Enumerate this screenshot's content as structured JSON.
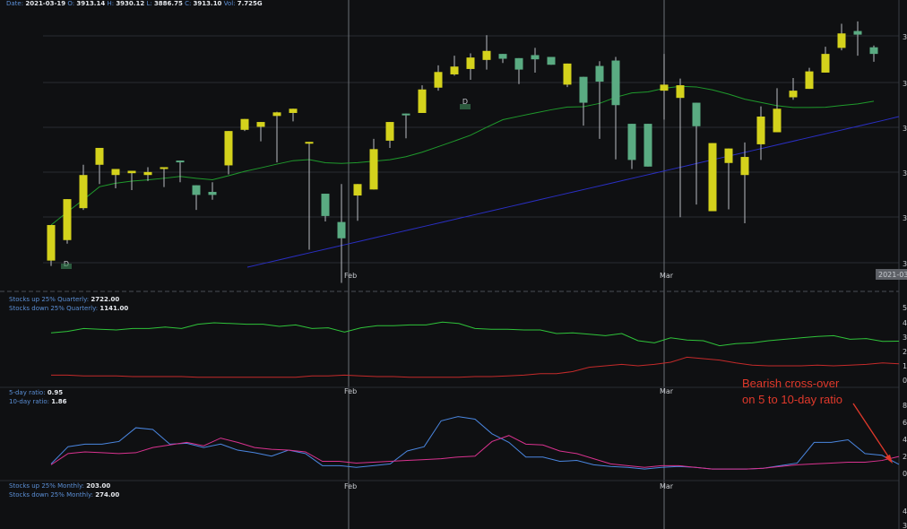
{
  "header": {
    "date_label": "Date:",
    "date": "2021-03-19",
    "o_label": "O:",
    "open": "3913.14",
    "h_label": "H:",
    "high": "3930.12",
    "l_label": "L:",
    "low": "3886.75",
    "c_label": "C:",
    "close": "3913.10",
    "vol_label": "Vol:",
    "vol": "7.725G"
  },
  "xaxis": {
    "labels": [
      "Feb",
      "Mar"
    ],
    "date_badge": "2021-03"
  },
  "price_panel": {
    "marker": "D",
    "yaxis_ticks": [
      "3",
      "3",
      "3",
      "3",
      "3",
      "3"
    ]
  },
  "quarterly_panel": {
    "up_label": "Stocks up 25% Quarterly:",
    "up_value": "2722.00",
    "down_label": "Stocks down 25% Quarterly:",
    "down_value": "1141.00",
    "yaxis_ticks": [
      "5",
      "4",
      "3",
      "2",
      "1",
      "0"
    ]
  },
  "ratio_panel": {
    "five_label": "5-day ratio:",
    "five_value": "0.95",
    "ten_label": "10-day ratio:",
    "ten_value": "1.86",
    "yaxis_ticks": [
      "8",
      "6",
      "4",
      "2",
      "0"
    ],
    "annotation_line1": "Bearish cross-over",
    "annotation_line2": "on 5 to 10-day ratio"
  },
  "monthly_panel": {
    "up_label": "Stocks up 25% Monthly:",
    "up_value": "203.00",
    "down_label": "Stocks down 25% Monthly:",
    "down_value": "274.00",
    "yaxis_ticks": [
      "4",
      "3"
    ]
  },
  "colors": {
    "bg": "#0f1012",
    "bull": "#d4d21c",
    "bear": "#5aab82",
    "ma_short": "#1f9a2c",
    "ma_long": "#2a2fc4",
    "q_up": "#2fc33a",
    "q_down": "#c42a2a",
    "ratio5": "#4a86e0",
    "ratio10": "#d9328f",
    "annotation": "#e0392b"
  },
  "chart_data": {
    "type": "line",
    "series": [
      {
        "name": "Stocks up 25% Quarterly",
        "values": [
          3.3,
          3.4,
          3.6,
          3.55,
          3.5,
          3.6,
          3.6,
          3.7,
          3.6,
          3.9,
          4.0,
          3.95,
          3.9,
          3.9,
          3.75,
          3.85,
          3.6,
          3.65,
          3.35,
          3.65,
          3.8,
          3.8,
          3.85,
          3.85,
          4.05,
          3.95,
          3.6,
          3.55,
          3.55,
          3.5,
          3.5,
          3.25,
          3.3,
          3.2,
          3.1,
          3.25,
          2.75,
          2.6,
          2.95,
          2.8,
          2.75,
          2.4,
          2.55,
          2.6,
          2.75,
          2.85,
          2.95,
          3.05,
          3.1,
          2.85,
          2.9,
          2.7,
          2.72
        ]
      },
      {
        "name": "Stocks down 25% Quarterly",
        "values": [
          0.35,
          0.35,
          0.3,
          0.3,
          0.3,
          0.25,
          0.25,
          0.25,
          0.25,
          0.2,
          0.2,
          0.2,
          0.2,
          0.2,
          0.2,
          0.2,
          0.3,
          0.3,
          0.35,
          0.3,
          0.25,
          0.25,
          0.2,
          0.2,
          0.2,
          0.2,
          0.25,
          0.25,
          0.3,
          0.35,
          0.45,
          0.45,
          0.6,
          0.9,
          1.0,
          1.1,
          1.0,
          1.1,
          1.25,
          1.6,
          1.5,
          1.4,
          1.2,
          1.05,
          1.0,
          1.0,
          1.0,
          1.05,
          1.0,
          1.05,
          1.1,
          1.2,
          1.14
        ]
      },
      {
        "name": "5-day ratio",
        "values": [
          1.0,
          3.0,
          3.3,
          3.3,
          3.6,
          5.2,
          5.0,
          3.3,
          3.4,
          2.9,
          3.3,
          2.6,
          2.3,
          1.9,
          2.6,
          2.2,
          0.8,
          0.8,
          0.6,
          0.8,
          1.0,
          2.5,
          3.0,
          6.0,
          6.5,
          6.2,
          4.5,
          3.5,
          1.8,
          1.8,
          1.3,
          1.4,
          0.9,
          0.7,
          0.6,
          0.4,
          0.6,
          0.7,
          0.6,
          0.4,
          0.4,
          0.4,
          0.5,
          0.8,
          1.1,
          3.5,
          3.5,
          3.8,
          2.2,
          2.0,
          0.95
        ]
      },
      {
        "name": "10-day ratio",
        "values": [
          0.9,
          2.2,
          2.4,
          2.3,
          2.2,
          2.3,
          2.9,
          3.2,
          3.5,
          3.1,
          4.0,
          3.5,
          2.9,
          2.7,
          2.6,
          2.4,
          1.3,
          1.3,
          1.1,
          1.2,
          1.3,
          1.4,
          1.5,
          1.6,
          1.8,
          1.9,
          3.6,
          4.3,
          3.3,
          3.2,
          2.5,
          2.2,
          1.6,
          1.0,
          0.8,
          0.6,
          0.8,
          0.8,
          0.6,
          0.4,
          0.4,
          0.4,
          0.5,
          0.7,
          0.9,
          1.0,
          1.1,
          1.2,
          1.2,
          1.4,
          1.86
        ]
      }
    ],
    "candles": [
      [
        3808,
        3867,
        3799,
        3842
      ],
      [
        3842,
        3910,
        3836,
        3895
      ],
      [
        3895,
        3950,
        3892,
        3967
      ],
      [
        3967,
        3995,
        3935,
        3983
      ],
      [
        3950,
        3960,
        3928,
        3955
      ],
      [
        3953,
        3957,
        3925,
        3951
      ],
      [
        3950,
        3955,
        3940,
        3963
      ],
      [
        3960,
        3963,
        3930,
        3946
      ],
      [
        3974,
        3972,
        3938,
        3941
      ],
      [
        3933,
        3917,
        3892,
        3911
      ],
      [
        3922,
        3917,
        3909,
        3938
      ],
      [
        3966,
        4023,
        3951,
        4022
      ],
      [
        4025,
        4043,
        4023,
        4043
      ],
      [
        4030,
        4038,
        4006,
        4033
      ],
      [
        4048,
        4054,
        3971,
        4055
      ],
      [
        4053,
        4060,
        4039,
        4056
      ],
      [
        4003,
        4005,
        3826,
        3919
      ],
      [
        3919,
        3882,
        3873,
        3913
      ],
      [
        3872,
        3845,
        3771,
        3935
      ],
      [
        3916,
        3935,
        3874,
        3913
      ],
      [
        3926,
        3993,
        3928,
        4010
      ],
      [
        4007,
        4038,
        3995,
        4020
      ],
      [
        4052,
        4050,
        4011,
        4049
      ],
      [
        4053,
        4092,
        4090,
        4099
      ],
      [
        4095,
        4121,
        4090,
        4132
      ],
      [
        4117,
        4130,
        4115,
        4148
      ],
      [
        4126,
        4145,
        4108,
        4152
      ],
      [
        4141,
        4156,
        4125,
        4182
      ],
      [
        4151,
        4143,
        4136,
        4150
      ],
      [
        4144,
        4125,
        4101,
        4143
      ],
      [
        4149,
        4142,
        4120,
        4161
      ],
      [
        4146,
        4133,
        4142,
        4140
      ],
      [
        4100,
        4135,
        4096,
        4120
      ],
      [
        4113,
        4070,
        4032,
        4111
      ],
      [
        4131,
        4105,
        4010,
        4139
      ],
      [
        4140,
        4066,
        3976,
        4146
      ],
      [
        4035,
        3975,
        3960,
        4014
      ],
      [
        4035,
        3964,
        3970,
        4021
      ],
      [
        4090,
        4100,
        4042,
        4151
      ],
      [
        4078,
        4099,
        3880,
        4110
      ],
      [
        4070,
        4031,
        3901,
        4063
      ],
      [
        3890,
        4003,
        3902,
        3927
      ],
      [
        3970,
        3994,
        3893,
        3983
      ],
      [
        3950,
        3980,
        3870,
        4004
      ],
      [
        4001,
        4047,
        3975,
        4064
      ],
      [
        4021,
        4060,
        4058,
        4094
      ],
      [
        4079,
        4090,
        4075,
        4111
      ],
      [
        4093,
        4122,
        4099,
        4128
      ],
      [
        4120,
        4151,
        4130,
        4163
      ],
      [
        4161,
        4185,
        4157,
        4201
      ],
      [
        4189,
        4183,
        4148,
        4205
      ],
      [
        4162,
        4151,
        4138,
        4165
      ]
    ]
  }
}
